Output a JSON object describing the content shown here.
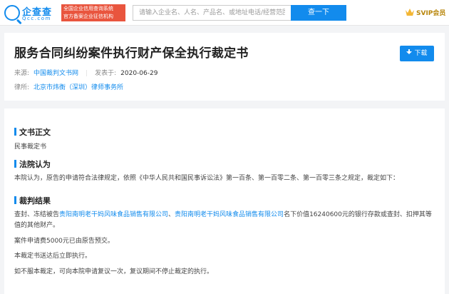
{
  "header": {
    "logo_name": "企查查",
    "logo_url": "Qcc.com",
    "badge_line1": "全国企业信用查询系统",
    "badge_line2": "官方备案企业征信机构",
    "search_placeholder": "请输入企业名、人名、产品名、或地址电话/经营范围等",
    "search_button": "查一下",
    "svip_label": "SVIP会员",
    "brand_color": "#128bed"
  },
  "document": {
    "title": "服务合同纠纷案件执行财产保全执行裁定书",
    "download_label": "下载",
    "source_label": "来源:",
    "source_value": "中国裁判文书网",
    "publish_label": "发表于:",
    "publish_date": "2020-06-29",
    "law_firm_label": "律所:",
    "law_firm_value": "北京市炜衡（深圳）律师事务所"
  },
  "content": {
    "section_title": "文书正文",
    "doc_type": "民事裁定书",
    "court_opinion_title": "法院认为",
    "court_opinion_text": "本院认为，原告的申请符合法律规定，依照《中华人民共和国民事诉讼法》第一百条、第一百零二条、第一百零三条之规定，裁定如下：",
    "result_title": "裁判结果",
    "result_p1_a": "查封、冻结被告",
    "result_p1_company1": "贵阳南明老干妈风味食品销售有限公司",
    "result_p1_sep": "、",
    "result_p1_company2": "贵阳南明老干妈风味食品销售有限公司",
    "result_p1_b": "名下价值16240600元的银行存款或查封、扣押其等值的其他财产。",
    "result_p2": "案件申请费5000元已由原告预交。",
    "result_p3": "本裁定书送达后立即执行。",
    "result_p4": "如不服本裁定，可向本院申请复议一次，复议期间不停止裁定的执行。"
  }
}
